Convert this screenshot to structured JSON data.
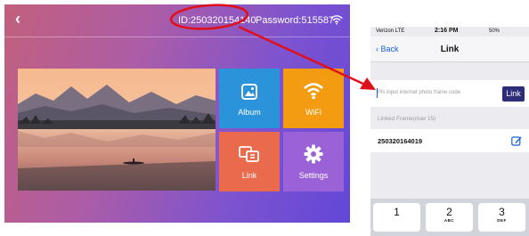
{
  "frame": {
    "back_icon": "chevron-left-icon",
    "device_id": "ID:250320154140",
    "password": "Password:515587",
    "status_icon": "wifi-icon",
    "tiles": [
      {
        "label": "Album",
        "icon": "picture-icon",
        "color": "#2a93d9"
      },
      {
        "label": "WiFi",
        "icon": "wifi-icon",
        "color": "#f39c12"
      },
      {
        "label": "Link",
        "icon": "link-screens-icon",
        "color": "#e96a4c"
      },
      {
        "label": "Settings",
        "icon": "gear-icon",
        "color": "#9b62d8"
      }
    ]
  },
  "annotation": {
    "color": "#e0101a"
  },
  "phone": {
    "status": {
      "carrier": "Verizon LTE",
      "time": "2:16 PM",
      "battery": "50%"
    },
    "nav": {
      "back_label": "Back",
      "title": "Link"
    },
    "input": {
      "placeholder": "Pls input internet photo frame code",
      "button_label": "Link"
    },
    "linked_label": "Linked Frame(max 15)",
    "linked_frames": [
      {
        "code": "250320164019"
      }
    ],
    "keyboard": [
      {
        "digit": "1",
        "letters": ""
      },
      {
        "digit": "2",
        "letters": "ABC"
      },
      {
        "digit": "3",
        "letters": "DEF"
      }
    ]
  }
}
